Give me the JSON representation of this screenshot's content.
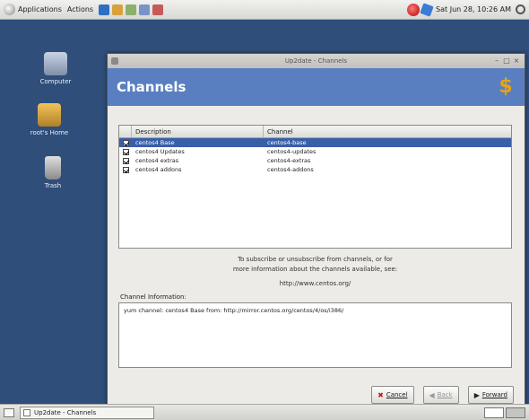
{
  "top_panel": {
    "menus": [
      "Applications",
      "Actions"
    ],
    "clock": "Sat Jun 28, 10:26 AM"
  },
  "desktop_icons": [
    {
      "label": "Computer",
      "icon": "computer-icon"
    },
    {
      "label": "root's Home",
      "icon": "home-folder-icon"
    },
    {
      "label": "Trash",
      "icon": "trash-icon"
    }
  ],
  "window": {
    "title": "Up2date - Channels",
    "header": "Channels",
    "list_columns": {
      "description": "Description",
      "channel": "Channel"
    },
    "channels": [
      {
        "description": "centos4 Base",
        "channel": "centos4-base",
        "checked": true,
        "selected": true
      },
      {
        "description": "centos4 Updates",
        "channel": "centos4-updates",
        "checked": true,
        "selected": false
      },
      {
        "description": "centos4 extras",
        "channel": "centos4-extras",
        "checked": true,
        "selected": false
      },
      {
        "description": "centos4 addons",
        "channel": "centos4-addons",
        "checked": true,
        "selected": false
      }
    ],
    "info_line1": "To subscribe or unsubscribe from channels, or for",
    "info_line2": "more information about the channels available, see:",
    "info_url": "http://www.centos.org/",
    "channel_info_label": "Channel Information:",
    "channel_info_text": "yum channel: centos4 Base from: http://mirror.centos.org/centos/4/os/i386/",
    "buttons": {
      "cancel": "Cancel",
      "back": "Back",
      "forward": "Forward"
    }
  },
  "bottom_panel": {
    "task": "Up2date - Channels"
  },
  "colors": {
    "header_band": "#5a7fc0",
    "desktop": "#2f4e7a",
    "selection": "#3a5fa8"
  }
}
